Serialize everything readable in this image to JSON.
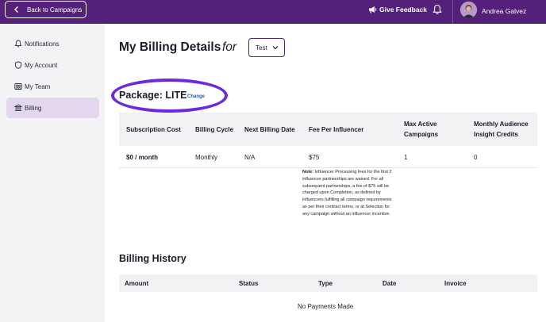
{
  "topbar": {
    "back_label": "Back to Campaigns",
    "feedback_label": "Give Feedback",
    "user_name": "Andrea Galvez",
    "bg_color": "#55207a"
  },
  "sidebar": {
    "items": [
      {
        "label": "Notifications",
        "icon": "bell-icon"
      },
      {
        "label": "My Account",
        "icon": "shield-icon"
      },
      {
        "label": "My Team",
        "icon": "team-icon"
      },
      {
        "label": "Billing",
        "icon": "bank-icon",
        "active": true
      }
    ]
  },
  "header": {
    "title": "My Billing Details",
    "for": "for",
    "selected_campaign": "Test"
  },
  "package": {
    "title": "Package: LITE",
    "change_label": "Change",
    "highlight_color": "#6b2ae0"
  },
  "billing_table": {
    "columns": [
      "Subscription Cost",
      "Billing Cycle",
      "Next Billing Date",
      "Fee Per Influencer",
      "Max Active Campaigns",
      "Monthly Audience Insight Credits"
    ],
    "row": [
      "$0 / month",
      "Monthly",
      "N/A",
      "$75",
      "1",
      "0"
    ],
    "note_label": "Note:",
    "note_text": " Influencer Processing fees for the first 2 influencer partnerships are waived. For all subsequent partnerships, a fee of $75 will be charged upon Completion, as defined by influencers fulfilling all campaign requirements as per their contract terms, or at Selection for any campaign without an influencer incentive."
  },
  "history": {
    "title": "Billing History",
    "columns": [
      "Amount",
      "Status",
      "Type",
      "Date",
      "Invoice"
    ],
    "empty_text": "No Payments Made"
  }
}
